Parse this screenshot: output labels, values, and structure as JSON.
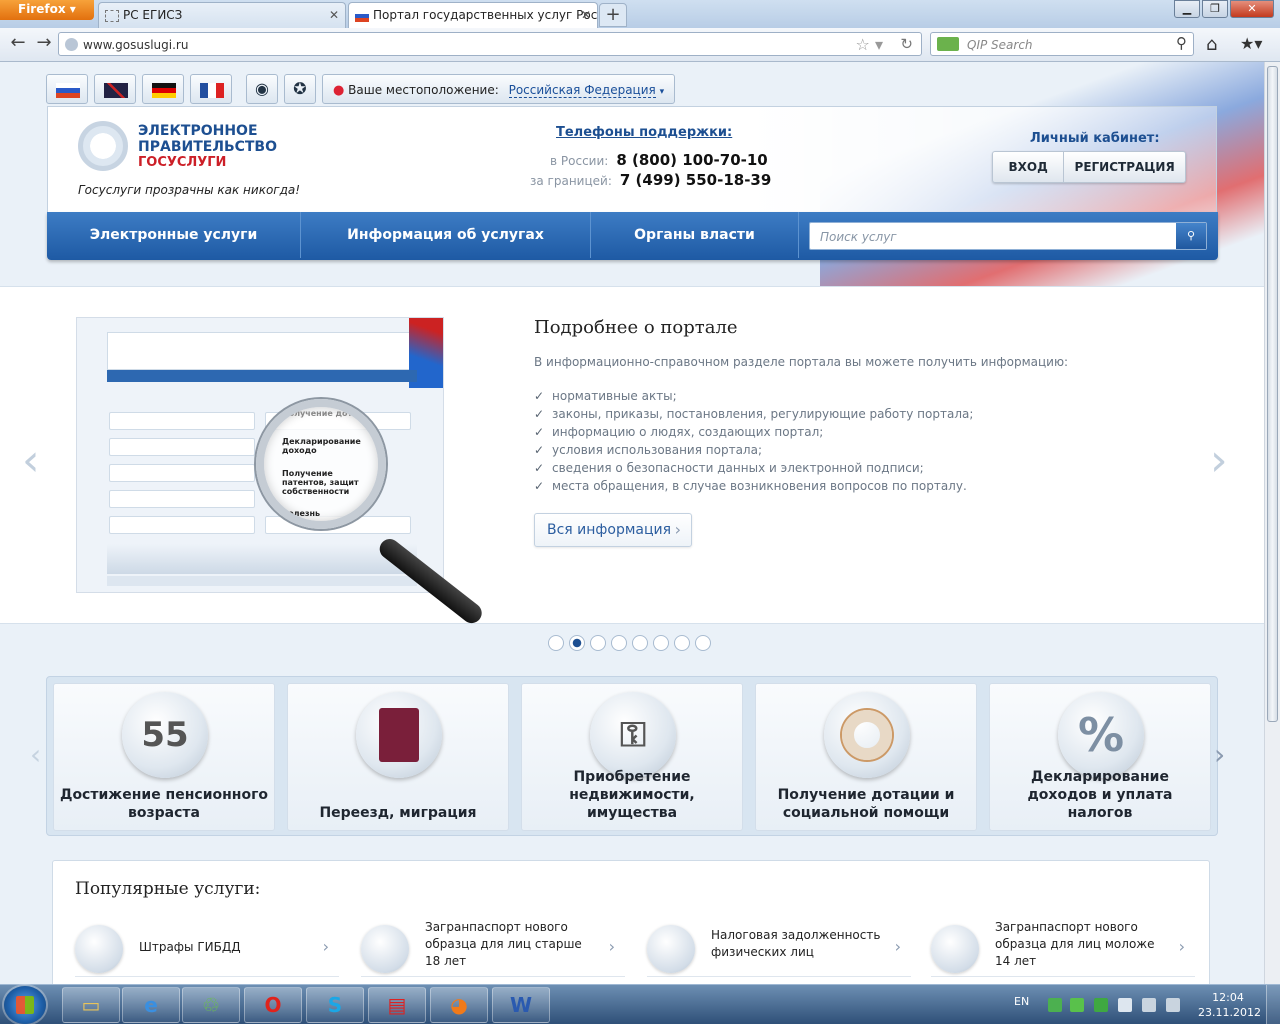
{
  "browser": {
    "app_button": "Firefox",
    "tabs": [
      {
        "label": "РС ЕГИСЗ",
        "active": false
      },
      {
        "label": "Портал государственных услуг Рос...",
        "active": true
      }
    ],
    "new_tab": "+",
    "url": "www.gosuslugi.ru",
    "search_placeholder": "QIP Search"
  },
  "page": {
    "location_label": "Ваше местоположение:",
    "location_value": "Российская Федерация",
    "logo_line1": "ЭЛЕКТРОННОЕ ПРАВИТЕЛЬСТВО",
    "logo_line2": "ГОСУСЛУГИ",
    "slogan": "Госуслуги прозрачны как никогда!",
    "support_title": "Телефоны поддержки",
    "support_rows": [
      {
        "label": "в России:",
        "phone": "8 (800) 100-70-10"
      },
      {
        "label": "за границей:",
        "phone": "7 (499) 550-18-39"
      }
    ],
    "cabinet_title": "Личный кабинет:",
    "login_label": "ВХОД",
    "register_label": "РЕГИСТРАЦИЯ",
    "menu": [
      "Электронные услуги",
      "Информация об услугах",
      "Органы власти"
    ],
    "search_placeholder": "Поиск услуг",
    "slide": {
      "title": "Подробнее о портале",
      "lead": "В информационно-справочном разделе портала вы можете получить информацию:",
      "items": [
        "нормативные акты;",
        "законы, приказы, постановления, регулирующие работу портала;",
        "информацию о людях, создающих портал;",
        "условия использования портала;",
        "сведения о безопасности данных и электронной подписи;",
        "места обращения, в случае возникновения вопросов по порталу."
      ],
      "button": "Вся информация",
      "preview_items": [
        "Получение дотаци",
        "Декларирование доходо",
        "Получение патентов, защит собственности",
        "Болезнь"
      ]
    },
    "slider_dots": {
      "count": 8,
      "active_index": 1
    },
    "categories": [
      {
        "label": "Достижение пенсионного возраста",
        "icon": "calendar-55-icon",
        "icon_text": "55"
      },
      {
        "label": "Переезд, миграция",
        "icon": "passport-icon",
        "icon_text": ""
      },
      {
        "label": "Приобретение недвижимости, имущества",
        "icon": "keys-icon",
        "icon_text": ""
      },
      {
        "label": "Получение дотации и социальной помощи",
        "icon": "lifebuoy-icon",
        "icon_text": ""
      },
      {
        "label": "Декларирование доходов и уплата налогов",
        "icon": "percent-icon",
        "icon_text": "%"
      }
    ],
    "popular_title": "Популярные услуги:",
    "popular": [
      {
        "label": "Штрафы ГИБДД",
        "icon": "traffic-light-icon"
      },
      {
        "label": "Загранпаспорт нового образца для лиц старше 18 лет",
        "icon": "passport-icon"
      },
      {
        "label": "Налоговая задолженность физических лиц",
        "icon": "tax-icon"
      },
      {
        "label": "Загранпаспорт нового образца для лиц моложе 14 лет",
        "icon": "passport-icon"
      }
    ]
  },
  "taskbar": {
    "language": "EN",
    "time": "12:04",
    "date": "23.11.2012"
  },
  "colors": {
    "brand_blue": "#1d4f91",
    "brand_red": "#cc1f27",
    "menu_blue": "#2b67b0"
  }
}
